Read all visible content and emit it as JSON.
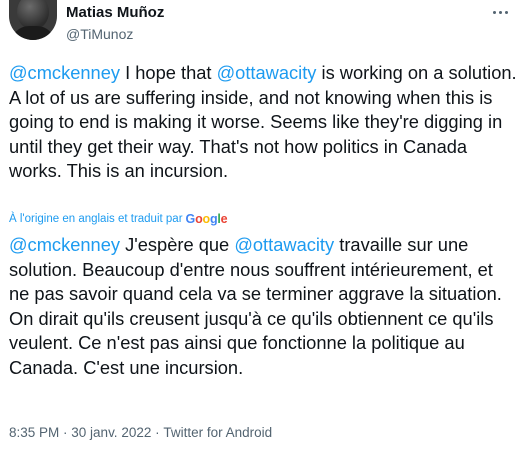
{
  "author": {
    "display_name": "Matias Muñoz",
    "handle": "@TiMunoz"
  },
  "tweet": {
    "original": {
      "mention_1": "@cmckenney",
      "text_1": " I hope that ",
      "mention_2": "@ottawacity",
      "text_2": " is working on a solution. A lot of us are suffering inside, and not knowing when this is going to end is making it worse. Seems like they're digging in until they get their way. That's not how politics in Canada works. This is an incursion."
    },
    "translation_label": "À l'origine en anglais et traduit par",
    "translation_provider": "Google",
    "translated": {
      "mention_1": "@cmckenney",
      "text_1": " J'espère que ",
      "mention_2": "@ottawacity",
      "text_2": " travaille sur une solution. Beaucoup d'entre nous souffrent intérieurement, et ne pas savoir quand cela va se terminer aggrave la situation. On dirait qu'ils creusent jusqu'à ce qu'ils obtiennent ce qu'ils veulent. Ce n'est pas ainsi que fonctionne la politique au Canada. C'est une incursion."
    },
    "time": "8:35 PM",
    "separator_1": " · ",
    "date": "30 janv. 2022",
    "separator_2": " · ",
    "source": "Twitter for Android"
  },
  "icons": {
    "more": "more-horizontal-icon",
    "avatar": "profile-photo"
  },
  "colors": {
    "link": "#1d9bf0",
    "text": "#0f1419",
    "secondary": "#536471",
    "background": "#ffffff"
  }
}
